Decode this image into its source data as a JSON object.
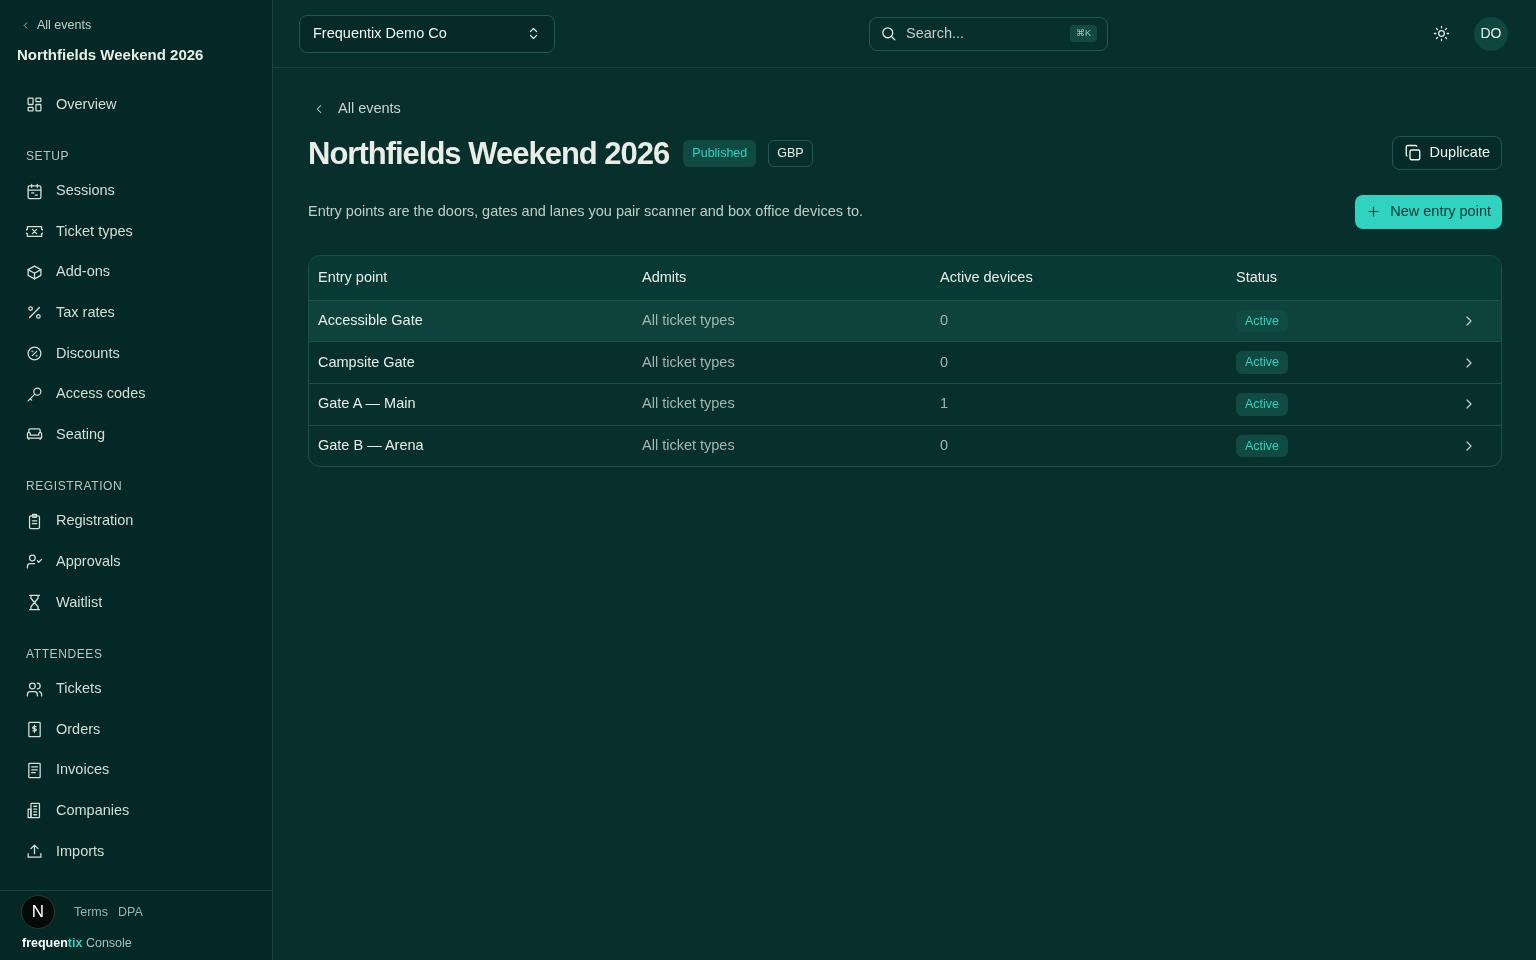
{
  "sidebar": {
    "back_link": "All events",
    "event_title": "Northfields Weekend 2026",
    "sections": [
      {
        "items": [
          {
            "label": "Overview"
          }
        ]
      },
      {
        "heading": "SETUP",
        "items": [
          {
            "label": "Sessions"
          },
          {
            "label": "Ticket types"
          },
          {
            "label": "Add-ons"
          },
          {
            "label": "Tax rates"
          },
          {
            "label": "Discounts"
          },
          {
            "label": "Access codes"
          },
          {
            "label": "Seating"
          }
        ]
      },
      {
        "heading": "REGISTRATION",
        "items": [
          {
            "label": "Registration"
          },
          {
            "label": "Approvals"
          },
          {
            "label": "Waitlist"
          }
        ]
      },
      {
        "heading": "ATTENDEES",
        "items": [
          {
            "label": "Tickets"
          },
          {
            "label": "Orders"
          },
          {
            "label": "Invoices"
          },
          {
            "label": "Companies"
          },
          {
            "label": "Imports"
          }
        ]
      }
    ],
    "footer_links": [
      "Terms",
      "DPA"
    ],
    "brand": {
      "part_1": "frequen",
      "part_2": "tix",
      "suffix": "Console"
    },
    "dev_badge": "N"
  },
  "topbar": {
    "org_select": "Frequentix Demo Co",
    "search": {
      "placeholder": "Search...",
      "shortcut": "⌘K"
    },
    "avatar": "DO"
  },
  "page": {
    "back_link": "All events",
    "title": "Northfields Weekend 2026",
    "badges": [
      {
        "label": "Published",
        "kind": "status"
      },
      {
        "label": "GBP",
        "kind": "outline"
      }
    ],
    "duplicate_button": "Duplicate",
    "description": "Entry points are the doors, gates and lanes you pair scanner and box office devices to.",
    "new_button": "New entry point"
  },
  "table": {
    "columns": [
      "Entry point",
      "Admits",
      "Active devices",
      "Status"
    ],
    "rows": [
      {
        "name": "Accessible Gate",
        "admits": "All ticket types",
        "devices": "0",
        "status": "Active",
        "highlighted": true
      },
      {
        "name": "Campsite Gate",
        "admits": "All ticket types",
        "devices": "0",
        "status": "Active",
        "highlighted": false
      },
      {
        "name": "Gate A — Main",
        "admits": "All ticket types",
        "devices": "1",
        "status": "Active",
        "highlighted": false
      },
      {
        "name": "Gate B — Arena",
        "admits": "All ticket types",
        "devices": "0",
        "status": "Active",
        "highlighted": false
      }
    ]
  }
}
